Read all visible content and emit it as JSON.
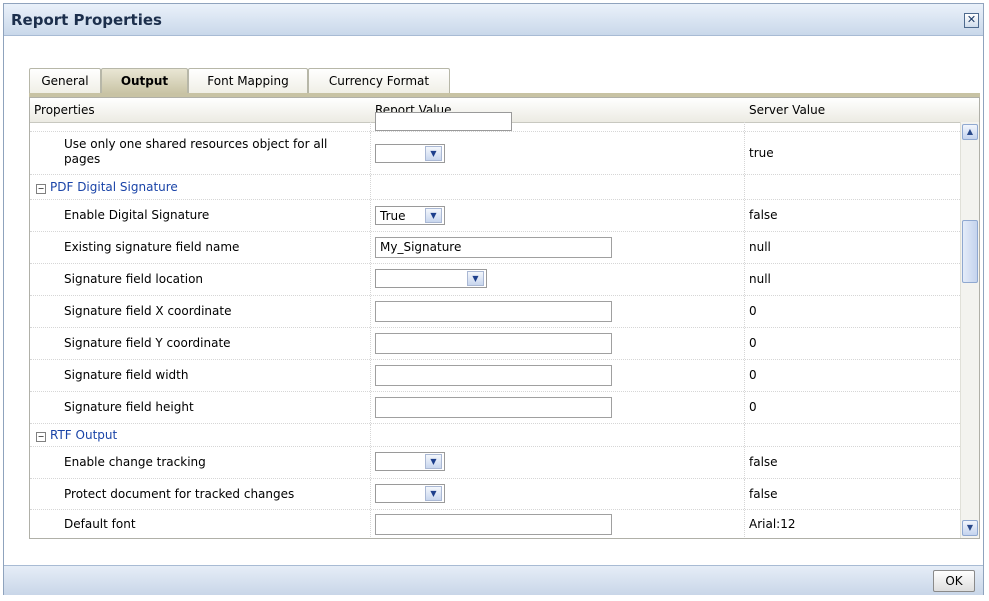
{
  "dialog": {
    "title": "Report Properties",
    "ok_label": "OK"
  },
  "tabs": [
    {
      "label": "General"
    },
    {
      "label": "Output"
    },
    {
      "label": "Font Mapping"
    },
    {
      "label": "Currency Format"
    }
  ],
  "table": {
    "headers": {
      "properties": "Properties",
      "report_value": "Report Value",
      "server_value": "Server Value"
    },
    "rows": [
      {
        "label": "Use only one shared resources object for all pages",
        "server": "true",
        "value": ""
      },
      {
        "section": "PDF Digital Signature"
      },
      {
        "label": "Enable Digital Signature",
        "server": "false",
        "value": "True"
      },
      {
        "label": "Existing signature field name",
        "server": "null",
        "value": "My_Signature"
      },
      {
        "label": "Signature field location",
        "server": "null",
        "value": ""
      },
      {
        "label": "Signature field X coordinate",
        "server": "0",
        "value": ""
      },
      {
        "label": "Signature field Y coordinate",
        "server": "0",
        "value": ""
      },
      {
        "label": "Signature field width",
        "server": "0",
        "value": ""
      },
      {
        "label": "Signature field height",
        "server": "0",
        "value": ""
      },
      {
        "section": "RTF Output"
      },
      {
        "label": "Enable change tracking",
        "server": "false",
        "value": ""
      },
      {
        "label": "Protect document for tracked changes",
        "server": "false",
        "value": ""
      },
      {
        "label": "Default font",
        "server": "Arial:12",
        "value": ""
      }
    ]
  },
  "icons": {
    "close": "close-icon",
    "dropdown": "chevron-down-icon",
    "collapse": "collapse-icon",
    "scroll_up": "arrow-up-icon",
    "scroll_down": "arrow-down-icon"
  }
}
